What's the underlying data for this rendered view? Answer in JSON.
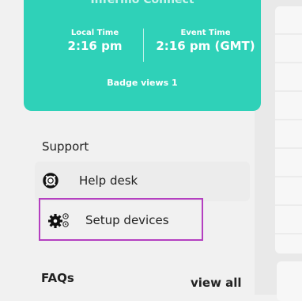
{
  "event_card": {
    "title": "Infermo Connect",
    "local_time_label": "Local Time",
    "local_time_value": "2:16 pm",
    "event_time_label": "Event Time",
    "event_time_value": "2:16 pm (GMT)",
    "badge_views": "Badge views 1",
    "color": "#2fd1b8"
  },
  "support": {
    "title": "Support",
    "items": [
      {
        "label": "Help desk",
        "icon": "lifebuoy-icon"
      },
      {
        "label": "Setup devices",
        "icon": "gears-icon",
        "highlight_color": "#b43fc0"
      }
    ]
  },
  "faqs": {
    "title": "FAQs",
    "view_all": "view all"
  }
}
